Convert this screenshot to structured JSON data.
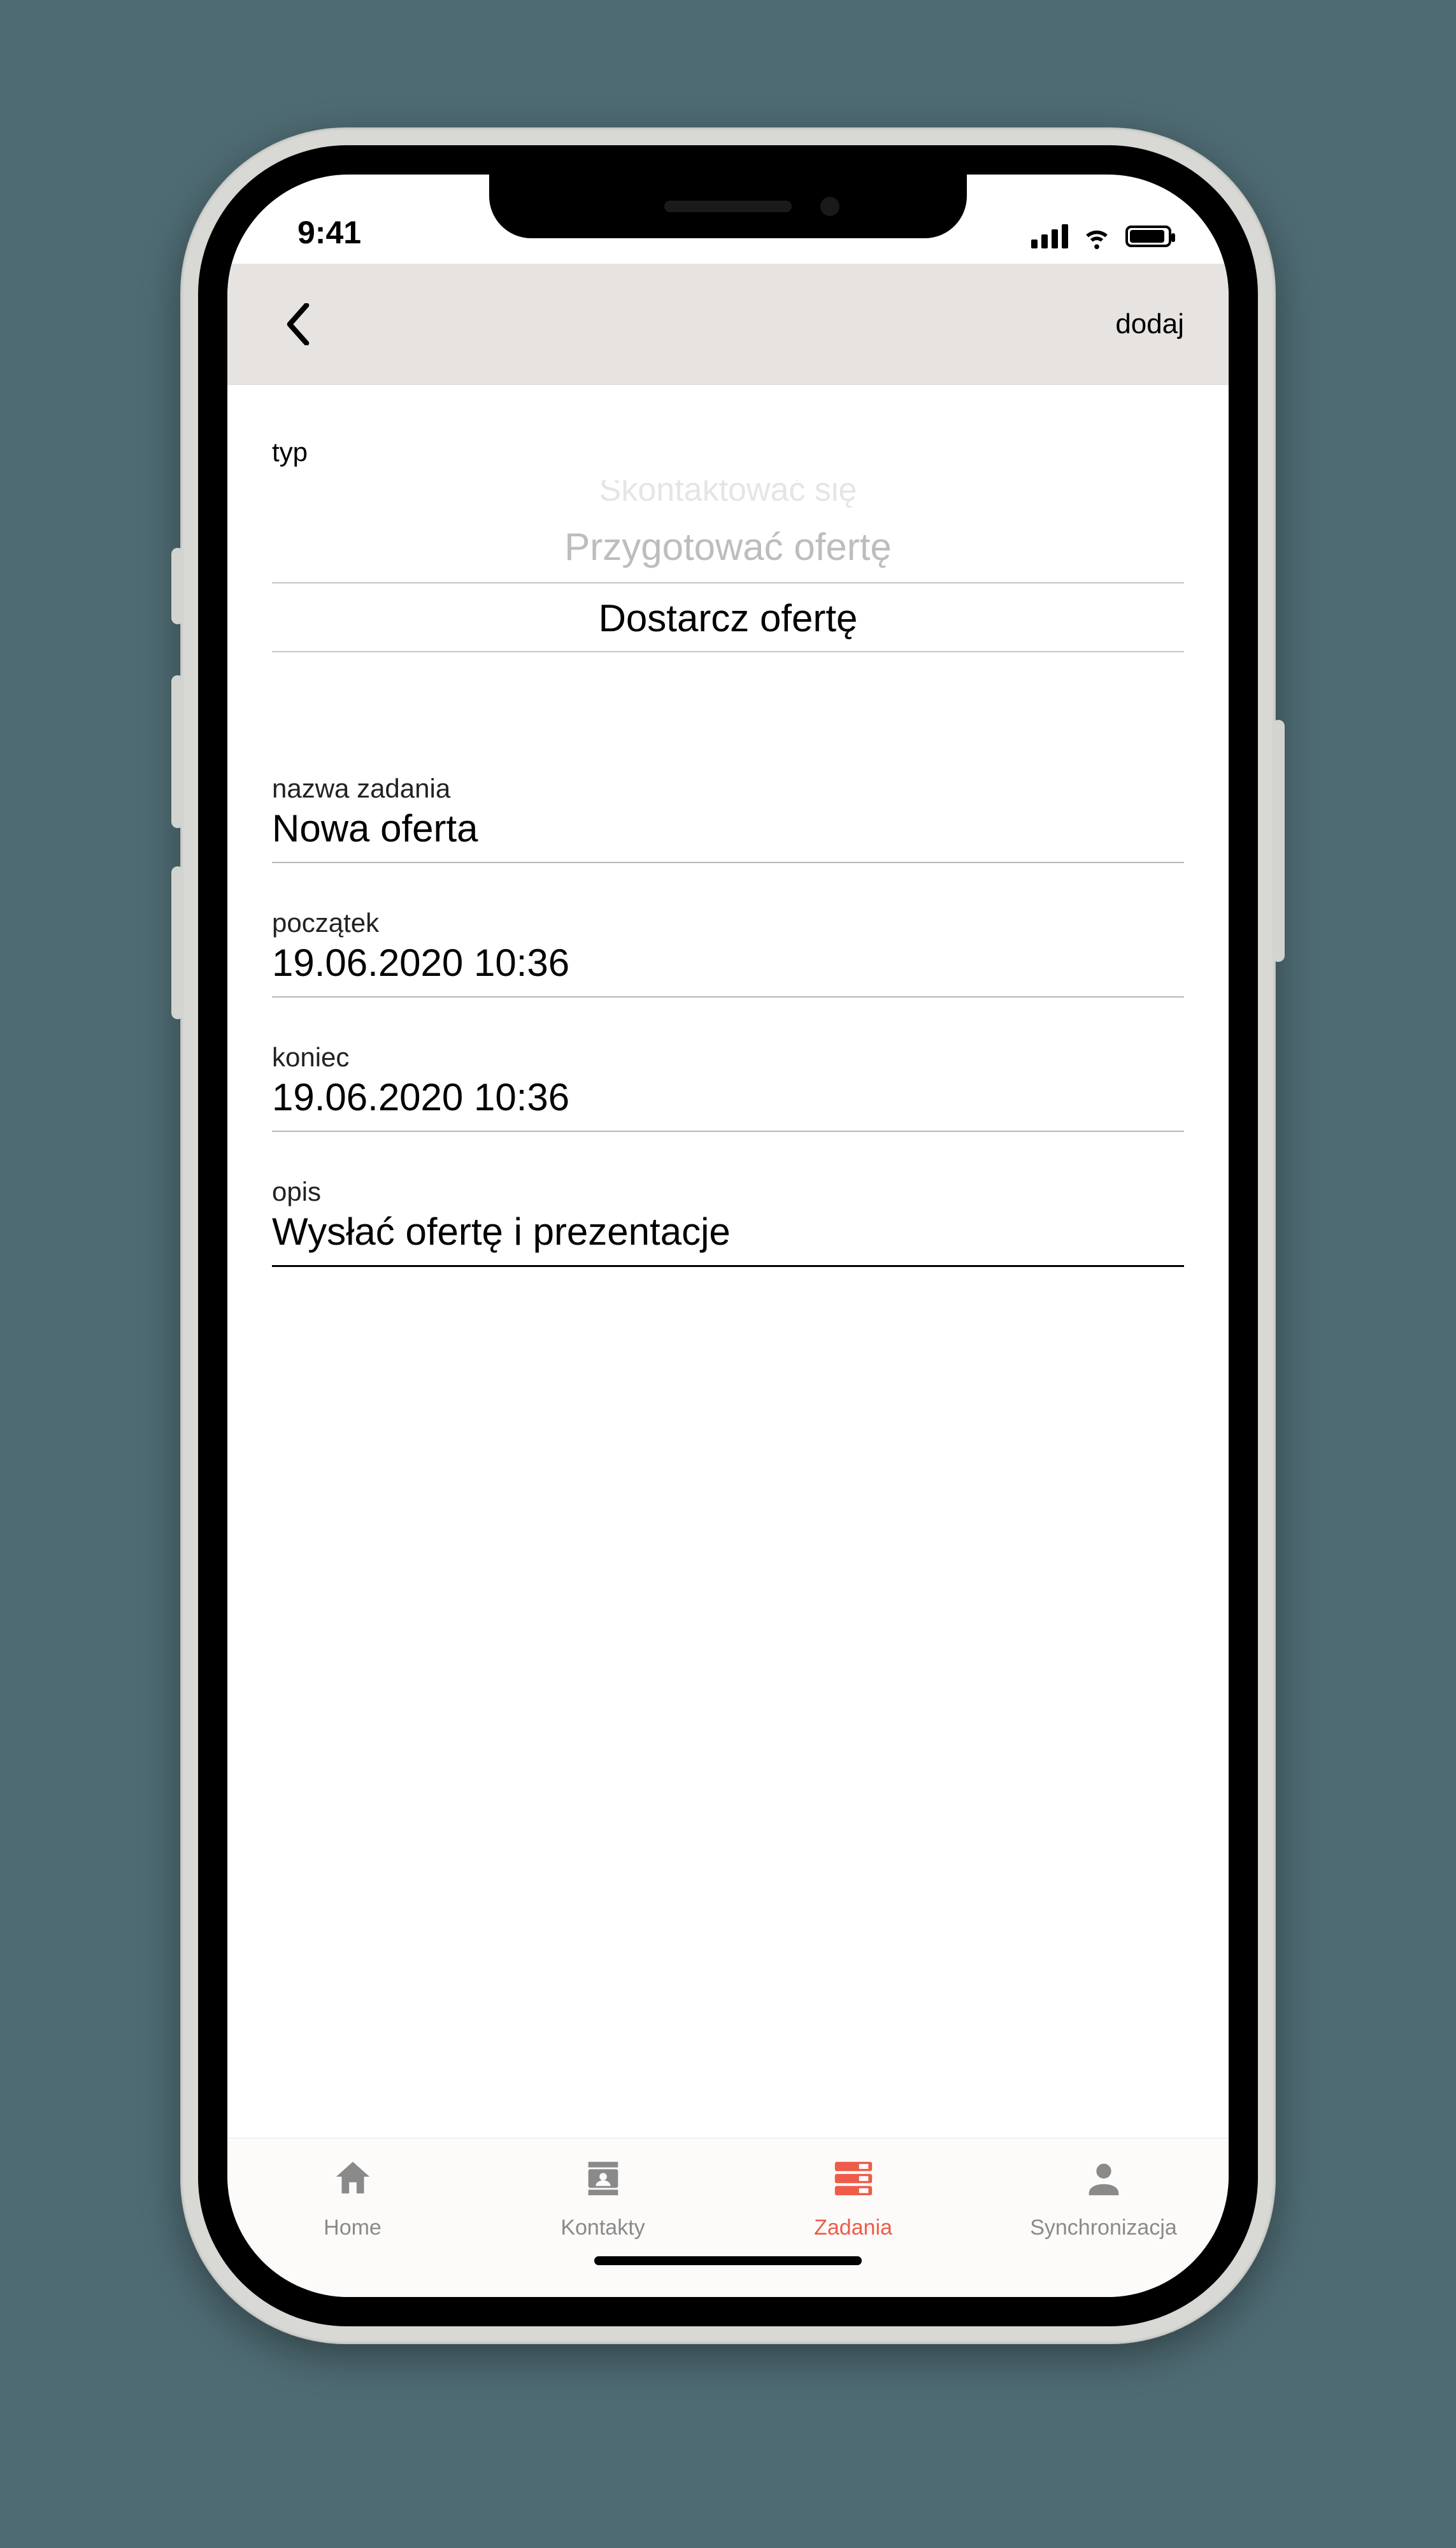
{
  "status": {
    "time": "9:41"
  },
  "header": {
    "action_label": "dodaj"
  },
  "type_section": {
    "label": "typ",
    "picker": {
      "faded": "Skontaktować się",
      "above": "Przygotować ofertę",
      "selected": "Dostarcz ofertę"
    }
  },
  "fields": {
    "name": {
      "label": "nazwa zadania",
      "value": "Nowa oferta"
    },
    "start": {
      "label": "początek",
      "value": "19.06.2020 10:36"
    },
    "end": {
      "label": "koniec",
      "value": "19.06.2020 10:36"
    },
    "desc": {
      "label": "opis",
      "value": "Wysłać ofertę i prezentacje"
    }
  },
  "tabs": {
    "home": {
      "label": "Home"
    },
    "contacts": {
      "label": "Kontakty"
    },
    "tasks": {
      "label": "Zadania"
    },
    "sync": {
      "label": "Synchronizacja"
    }
  },
  "colors": {
    "accent": "#ef5c49"
  }
}
